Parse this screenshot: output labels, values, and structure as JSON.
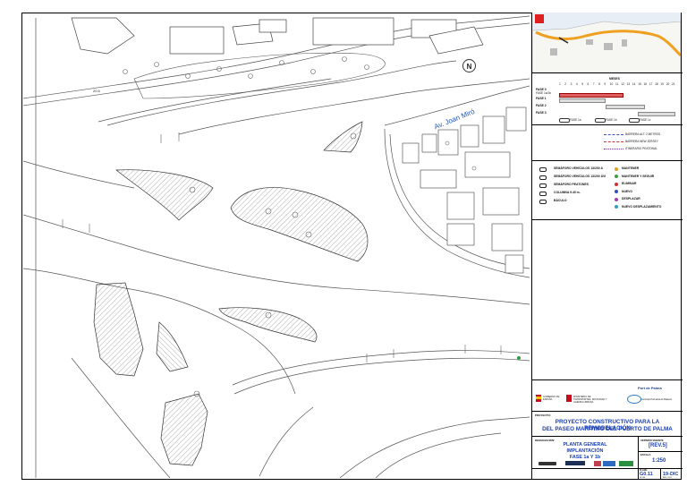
{
  "map": {
    "street_name": "Av. Joan Miró",
    "north_label": "N",
    "elevation_label": "20.5"
  },
  "phases": {
    "title": "MESES",
    "months": [
      "1",
      "2",
      "3",
      "4",
      "5",
      "6",
      "7",
      "8",
      "9",
      "10",
      "11",
      "12",
      "13",
      "14",
      "15",
      "16",
      "17",
      "18",
      "19",
      "20",
      "21"
    ],
    "rows": [
      {
        "label": "FASE 0",
        "sub": "FASE 1a/1b"
      },
      {
        "label": "FASE 1"
      },
      {
        "label": "FASE 2"
      },
      {
        "label": "FASE 3"
      }
    ],
    "legend": [
      "FASE 1a",
      "FASE 1b",
      "FASE 1c"
    ]
  },
  "line_legend": {
    "items": [
      {
        "label": "BARRERA ALT. 2 METROS",
        "color": "#3a54c0"
      },
      {
        "label": "BARRERA NEW JERSEY",
        "color": "#c03a3a"
      },
      {
        "label": "ITINERARIO PEATONAL",
        "color": "#7a3aa0"
      }
    ]
  },
  "symbol_legend": {
    "left": [
      "SEMÁFORO VEHÍCULOS 13/200 A",
      "SEMÁFORO VEHÍCULOS 13/200 ÁVI",
      "SEMÁFORO PEATONES",
      "COLUMNA 9.40 m.",
      "BÁCULO"
    ],
    "right": [
      {
        "label": "MANTENER",
        "color": "#e0a020"
      },
      {
        "label": "MANTENER Y SEGUIR",
        "color": "#3aa040"
      },
      {
        "label": "ELIMINAR",
        "color": "#d03030"
      },
      {
        "label": "NUEVO",
        "color": "#3050c0"
      },
      {
        "label": "DESPLAZAR",
        "color": "#a040b0"
      },
      {
        "label": "NUEVO DESPLAZAMIENTO",
        "color": "#30a0c0"
      }
    ]
  },
  "logos": {
    "left": "GOBIERNO DE ESPAÑA",
    "ministry": "MINISTERIO DE TRANSPORTES, MOVILIDAD Y AGENDA URBANA",
    "port": "Port de Palma",
    "authority": "Autoritat Portuària de Balears"
  },
  "title_block": {
    "project_caption": "PROYECTO:",
    "project_title_1": "PROYECTO CONSTRUCTIVO PARA LA REMODELACIÓN",
    "project_title_2": "DEL PASEO MARÍTIMO DEL PUERTO DE PALMA",
    "drawing_caption": "DESIGNACIÓN:",
    "drawing_1": "PLANTA GENERAL",
    "drawing_2": "IMPLANTACIÓN",
    "drawing_3": "FASE 1a Y 1b",
    "revision_caption": "VERSIÓN VIGENTE",
    "revision": "[REV.5]",
    "scale_caption": "ESCALA",
    "scale": "1:250",
    "plan_caption": "PLANO",
    "plan_number": "G0.11",
    "date": "19-DIC",
    "sheet_caption": "HOJA",
    "year_caption": "AÑO 2021"
  }
}
